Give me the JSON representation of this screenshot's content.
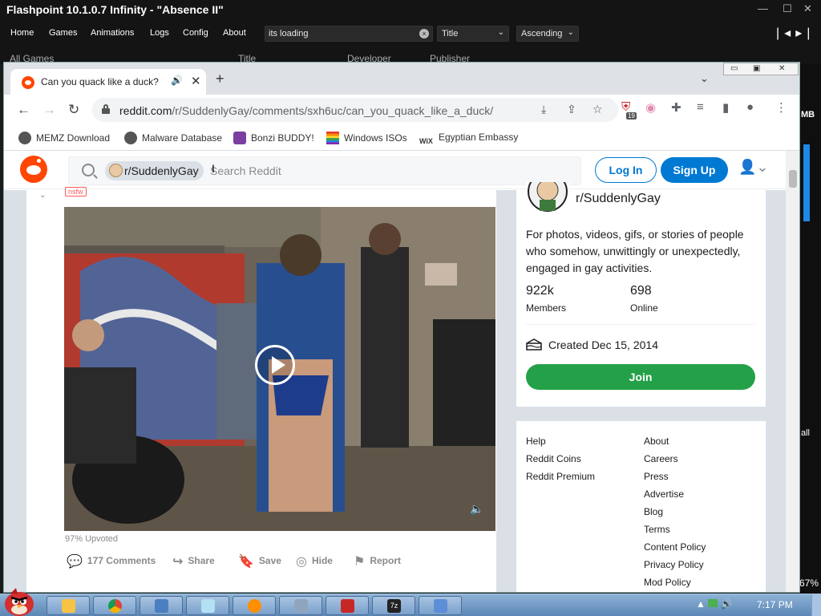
{
  "flashpoint": {
    "window_title": "Flashpoint 10.1.0.7 Infinity - \"Absence II\"",
    "menu": [
      "Home",
      "Games",
      "Animations",
      "Logs",
      "Config",
      "About"
    ],
    "search_value": "its loading",
    "order_by": "Title",
    "order_direction": "Ascending",
    "list_headers": {
      "all_games": "All Games",
      "title": "Title",
      "developer": "Developer",
      "publisher": "Publisher"
    },
    "edge_texts": {
      "mb": "MB",
      "all": "all",
      "percent": "67%"
    }
  },
  "chrome": {
    "tab_title": "Can you quack like a duck? - r/",
    "url_host": "reddit.com",
    "url_path": "/r/SuddenlyGay/comments/sxh6uc/can_you_quack_like_a_duck/",
    "extension_badge": "19",
    "bookmarks": [
      {
        "label": "MEMZ Download",
        "icon": "globe-icon",
        "color": "#4a4a4a"
      },
      {
        "label": "Malware Database",
        "icon": "globe-icon",
        "color": "#4a4a4a"
      },
      {
        "label": "Bonzi BUDDY!",
        "icon": "bonzi-icon",
        "color": "#7b3fa0"
      },
      {
        "label": "Windows ISOs",
        "icon": "rainbow-flag-icon",
        "color": "#e91e63"
      },
      {
        "label": "Egyptian Embassy",
        "icon": "wix-icon",
        "color": "#000000"
      }
    ]
  },
  "reddit": {
    "search_chip": "r/SuddenlyGay",
    "search_placeholder": "Search Reddit",
    "login_label": "Log In",
    "signup_label": "Sign Up",
    "nsfw_tag": "nsfw",
    "upvoted": "97% Upvoted",
    "actions": {
      "comments": "177 Comments",
      "share": "Share",
      "save": "Save",
      "hide": "Hide",
      "report": "Report"
    },
    "sidebar": {
      "name": "r/SuddenlyGay",
      "description": "For photos, videos, gifs, or stories of people who somehow, unwittingly or unexpectedly, engaged in gay activities.",
      "members_count": "922k",
      "members_label": "Members",
      "online_count": "698",
      "online_label": "Online",
      "created": "Created Dec 15, 2014",
      "join_label": "Join"
    },
    "footer_links_left": [
      "Help",
      "Reddit Coins",
      "Reddit Premium"
    ],
    "footer_links_right": [
      "About",
      "Careers",
      "Press",
      "Advertise",
      "Blog",
      "Terms",
      "Content Policy",
      "Privacy Policy",
      "Mod Policy"
    ]
  },
  "taskbar": {
    "clock": "7:17 PM",
    "apps": [
      "explorer",
      "chrome",
      "virtualbox",
      "notepad",
      "search-tool",
      "network",
      "flashpoint",
      "7zip",
      "keyboard"
    ]
  },
  "colors": {
    "reddit_orange": "#ff4500",
    "reddit_blue": "#0079d3",
    "join_green": "#24a148"
  }
}
